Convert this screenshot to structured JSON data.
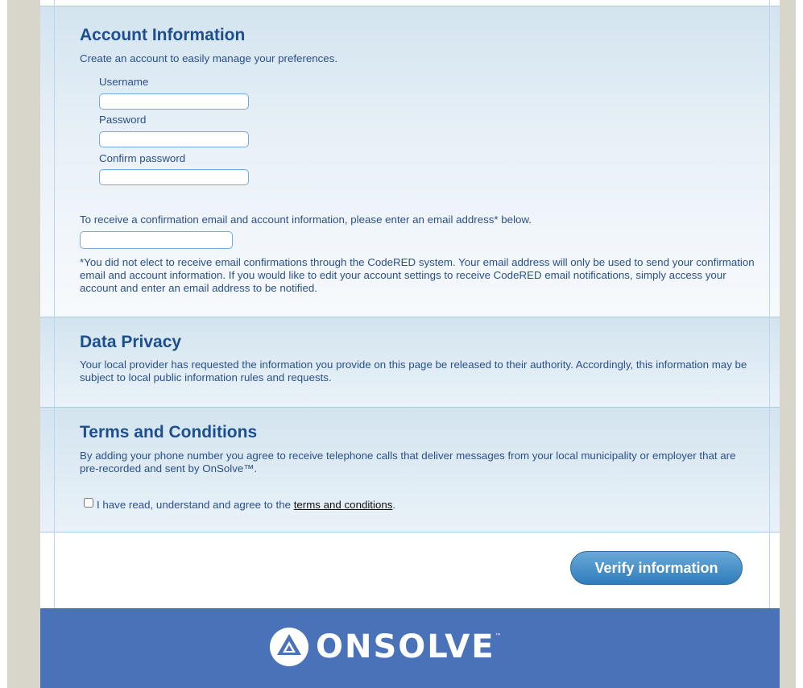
{
  "account": {
    "title": "Account Information",
    "subtitle": "Create an account to easily manage your preferences.",
    "username_label": "Username",
    "username_value": "",
    "password_label": "Password",
    "password_value": "",
    "confirm_label": "Confirm password",
    "confirm_value": "",
    "email_prompt": "To receive a confirmation email and account information, please enter an email address* below.",
    "email_value": "",
    "email_note": "*You did not elect to receive email confirmations through the CodeRED system. Your email address will only be used to send your confirmation email and account information. If you would like to edit your account settings to receive CodeRED email notifications, simply access your account and enter an email address to be notified."
  },
  "privacy": {
    "title": "Data Privacy",
    "text": "Your local provider has requested the information you provide on this page be released to their authority. Accordingly, this information may be subject to local public information rules and requests."
  },
  "terms": {
    "title": "Terms and Conditions",
    "text": "By adding your phone number you agree to receive telephone calls that deliver messages from your local municipality or employer that are pre-recorded and sent by OnSolve™.",
    "agree_prefix": "I have read, understand and agree to the ",
    "agree_link": "terms and conditions",
    "agree_suffix": ".",
    "agree_checked": false
  },
  "actions": {
    "verify_label": "Verify information"
  },
  "footer": {
    "logo_text": "ONSOLVE",
    "logo_tm": "™",
    "logo_icon": "onsolve-logo-icon"
  },
  "colors": {
    "heading": "#1d4f8f",
    "text": "#2a4f8c",
    "footer_bg": "#4a72b8",
    "button": "#2f7cbc"
  }
}
